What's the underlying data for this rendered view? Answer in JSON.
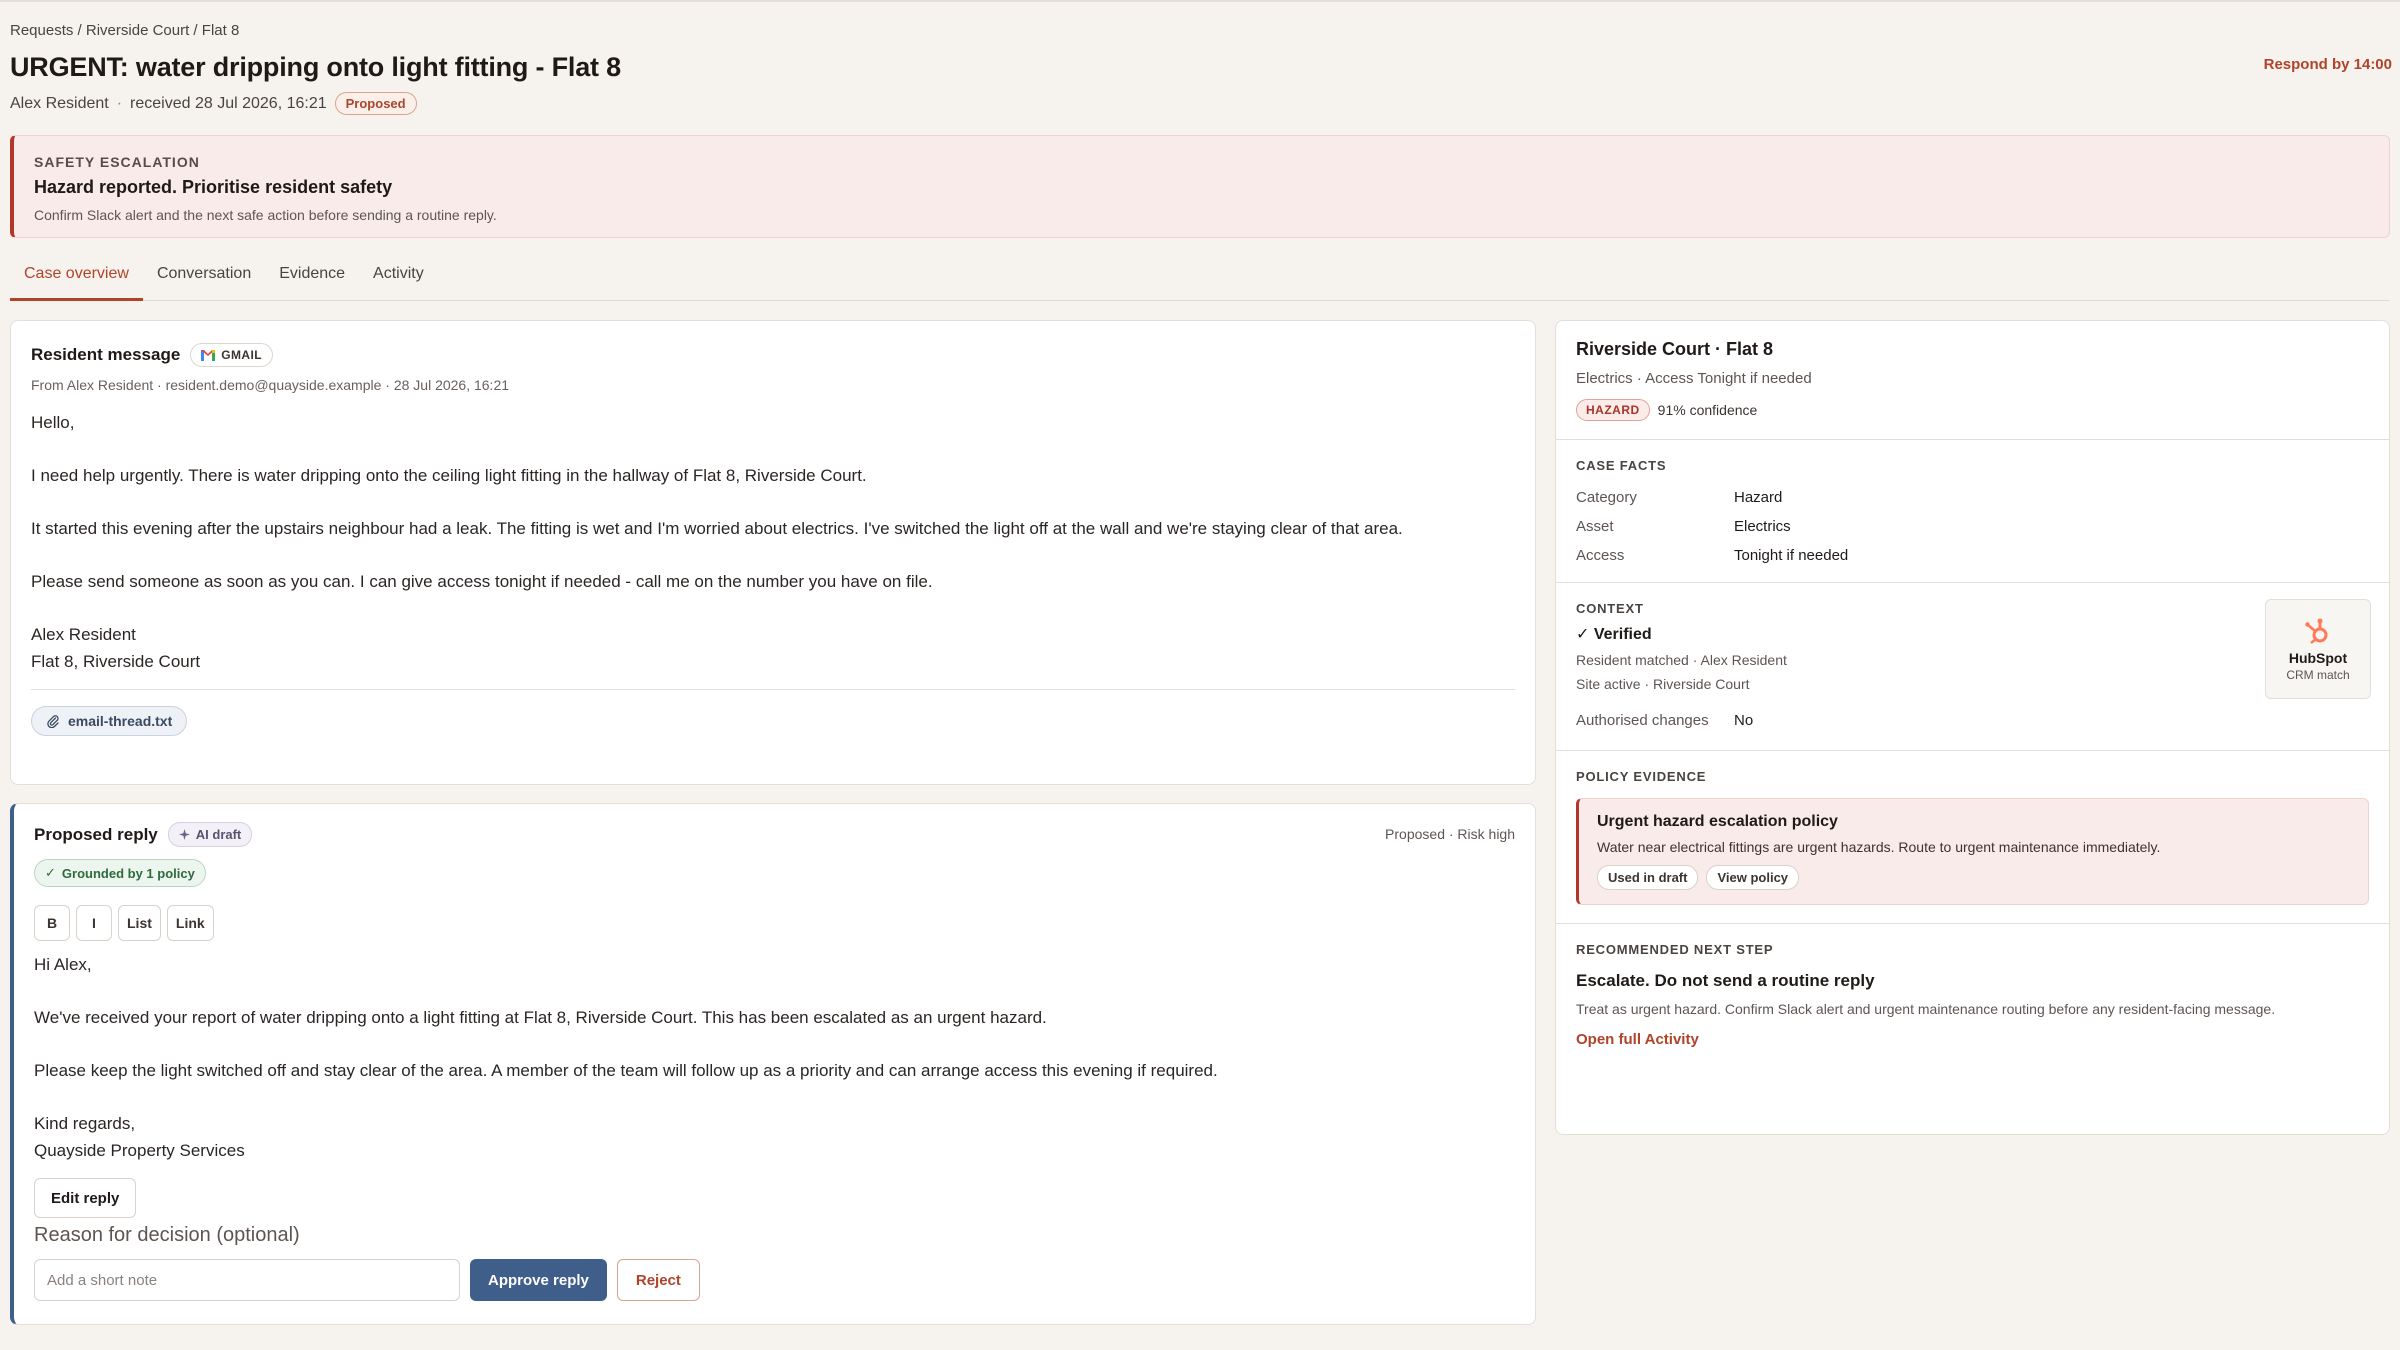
{
  "breadcrumb": [
    "Requests",
    "Riverside Court",
    "Flat 8"
  ],
  "breadcrumb_sep": " / ",
  "title": "URGENT: water dripping onto light fitting - Flat 8",
  "respond_by": "Respond by 14:00",
  "meta": {
    "resident": "Alex Resident",
    "separator": "·",
    "received": "received 28 Jul 2026, 16:21",
    "status": "Proposed"
  },
  "escalation": {
    "kicker": "SAFETY ESCALATION",
    "title": "Hazard reported. Prioritise resident safety",
    "text": "Confirm Slack alert and the next safe action before sending a routine reply."
  },
  "tabs": [
    "Case overview",
    "Conversation",
    "Evidence",
    "Activity"
  ],
  "message": {
    "title": "Resident message",
    "source": "GMAIL",
    "from": "From Alex Resident · resident.demo@quayside.example · 28 Jul 2026, 16:21",
    "paragraphs": [
      "Hello,",
      "I need help urgently. There is water dripping onto the ceiling light fitting in the hallway of Flat 8, Riverside Court.",
      "It started this evening after the upstairs neighbour had a leak. The fitting is wet and I'm worried about electrics. I've switched the light off at the wall and we're staying clear of that area.",
      "Please send someone as soon as you can. I can give access tonight if needed - call me on the number you have on file."
    ],
    "signature": [
      "Alex Resident",
      "Flat 8, Riverside Court"
    ],
    "attachment": "email-thread.txt"
  },
  "reply": {
    "title": "Proposed reply",
    "ai_chip": "AI draft",
    "meta": "Proposed · Risk high",
    "grounded": "Grounded by 1 policy",
    "format_buttons": [
      "B",
      "I",
      "List",
      "Link"
    ],
    "paragraphs": [
      "Hi Alex,",
      "We've received your report of water dripping onto a light fitting at Flat 8, Riverside Court. This has been escalated as an urgent hazard.",
      "Please keep the light switched off and stay clear of the area. A member of the team will follow up as a priority and can arrange access this evening if required."
    ],
    "signoff": [
      "Kind regards,",
      "Quayside Property Services"
    ],
    "edit_label": "Edit reply",
    "reason_label": "Reason for decision (optional)",
    "note_placeholder": "Add a short note",
    "approve_label": "Approve reply",
    "reject_label": "Reject"
  },
  "side": {
    "title": "Riverside Court · Flat 8",
    "subtitle": "Electrics · Access Tonight if needed",
    "hazard_badge": "HAZARD",
    "confidence": "91% confidence",
    "facts_kicker": "CASE FACTS",
    "facts": [
      {
        "k": "Category",
        "v": "Hazard"
      },
      {
        "k": "Asset",
        "v": "Electrics"
      },
      {
        "k": "Access",
        "v": "Tonight if needed"
      }
    ],
    "context_kicker": "CONTEXT",
    "verified": "✓ Verified",
    "context_lines": [
      "Resident matched · Alex Resident",
      "Site active · Riverside Court"
    ],
    "authorised_label": "Authorised changes",
    "authorised_value": "No",
    "hubspot_name": "HubSpot",
    "hubspot_sub": "CRM match",
    "policy_kicker": "POLICY EVIDENCE",
    "policy_title": "Urgent hazard escalation policy",
    "policy_text": "Water near electrical fittings are urgent hazards. Route to urgent maintenance immediately.",
    "policy_chips": [
      "Used in draft",
      "View policy"
    ],
    "next_kicker": "RECOMMENDED NEXT STEP",
    "next_title": "Escalate. Do not send a routine reply",
    "next_text": "Treat as urgent hazard. Confirm Slack alert and urgent maintenance routing before any resident-facing message.",
    "next_link": "Open full Activity"
  },
  "colors": {
    "accent": "#b0432a",
    "primary": "#3f5e8a",
    "danger": "#b3362c",
    "background": "#f6f3ee"
  }
}
